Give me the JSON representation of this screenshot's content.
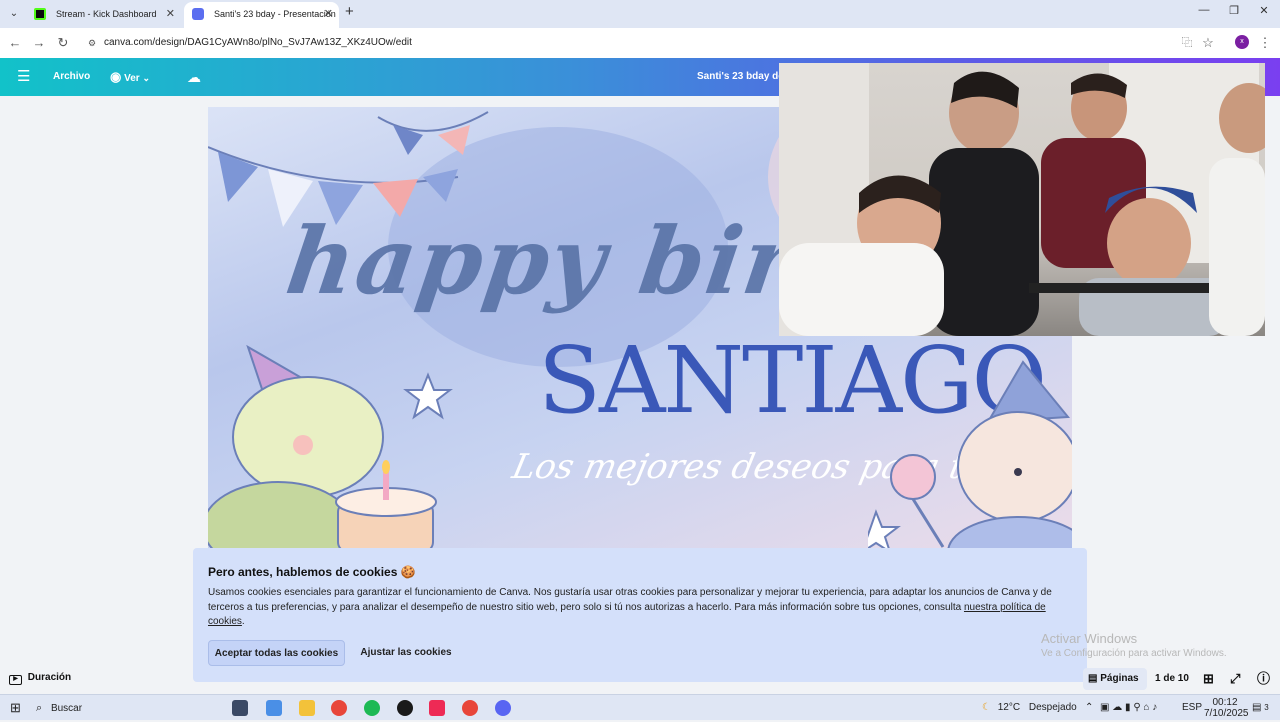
{
  "browser": {
    "tabs": [
      {
        "title": "Stream - Kick Dashboard",
        "favicon_color": "#53fc18"
      },
      {
        "title": "Santi's 23 bday - Presentación",
        "favicon_color": "#7d2ae8"
      }
    ],
    "url": "canva.com/design/DAG1CyAWn8o/plNo_SvJ7Aw13Z_XKz4UOw/edit",
    "profile_initial": "x"
  },
  "canva": {
    "menu_file": "Archivo",
    "menu_view": "Ver",
    "doc_title": "Santi's 23 bday de"
  },
  "slide": {
    "headline": "happy birt",
    "name": "SANTIAGO",
    "subtitle": "Los mejores deseos para ti"
  },
  "cookie_banner": {
    "title": "Pero antes, hablemos de cookies 🍪",
    "body_before_link": "Usamos cookies esenciales para garantizar el funcionamiento de Canva. Nos gustaría usar otras cookies para personalizar y mejorar tu experiencia, para adaptar los anuncios de Canva y de terceros a tus preferencias, y para analizar el desempeño de nuestro sitio web, pero solo si tú nos autorizas a hacerlo. Para más información sobre tus opciones, consulta ",
    "link": "nuestra política de cookies",
    "body_after_link": ".",
    "accept_label": "Aceptar todas las cookies",
    "adjust_label": "Ajustar las cookies"
  },
  "watermark": {
    "line1": "Activar Windows",
    "line2": "Ve a Configuración para activar Windows."
  },
  "footer": {
    "duration_label": "Duración",
    "pages_label": "Páginas",
    "page_counter": "1 de 10"
  },
  "taskbar": {
    "search_placeholder": "Buscar",
    "weather_temp": "12°C",
    "weather_desc": "Despejado",
    "language": "ESP",
    "time": "00:12",
    "date": "7/10/2025",
    "notification_count": "3"
  }
}
